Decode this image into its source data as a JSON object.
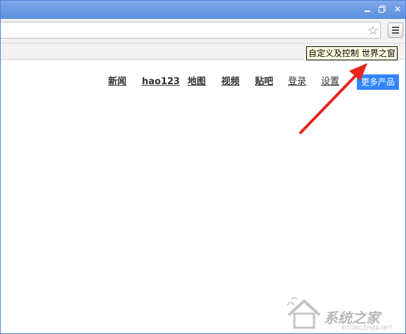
{
  "window": {
    "controls": {
      "minimize_icon": "minimize-icon",
      "maximize_icon": "restore-icon",
      "close_symbol": "✕"
    },
    "titlebar_color": "#6b9ae0"
  },
  "toolbar": {
    "address_value": "",
    "star_symbol": "☆",
    "menu_icon": "hamburger-menu-icon"
  },
  "tooltip": {
    "text": "自定义及控制 世界之窗"
  },
  "nav": {
    "items": [
      {
        "label": "新闻"
      },
      {
        "label": "hao123"
      },
      {
        "label": "地图"
      },
      {
        "label": "视频"
      },
      {
        "label": "贴吧"
      },
      {
        "label": "登录"
      },
      {
        "label": "设置"
      }
    ],
    "more_products": "更多产品",
    "more_products_color": "#3385ff"
  },
  "annotation": {
    "arrow_color": "#e8231a"
  },
  "watermark": {
    "text": "系统之家",
    "sub": "XITONGZHIJIA.NET"
  }
}
